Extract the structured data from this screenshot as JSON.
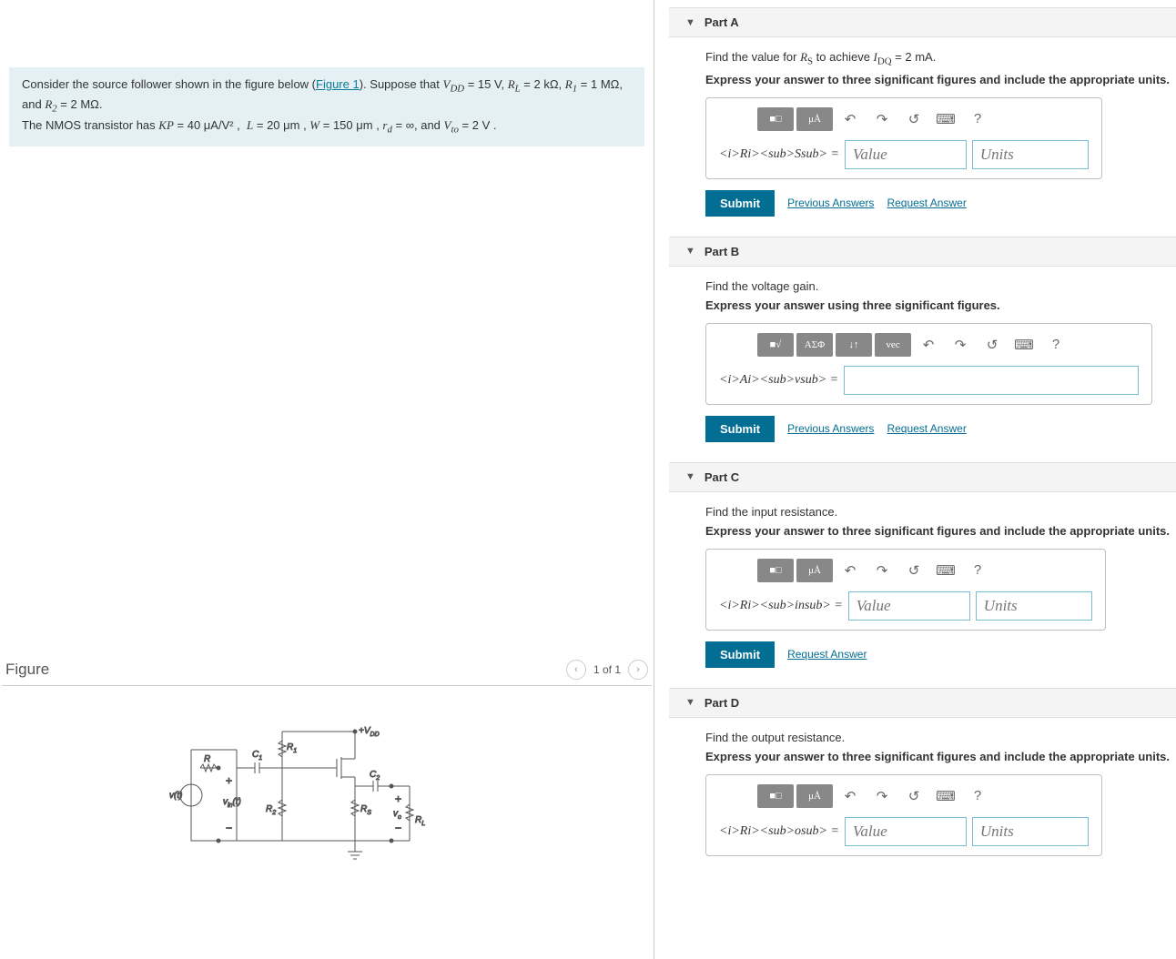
{
  "intro": {
    "preText": "Consider the source follower shown in the figure below (",
    "figLink": "Figure 1",
    "postText": "). Suppose that ",
    "params": "V_DD = 15 V, R_L = 2 kΩ, R_1 = 1 MΩ, and R_2 = 2 MΩ.",
    "line2pre": "The NMOS transistor has ",
    "line2": "KP = 40 μA/V² ,  L = 20 μm ,  W = 150 μm , r_d = ∞, and V_to = 2 V ."
  },
  "figure": {
    "title": "Figure",
    "pager": "1 of 1"
  },
  "parts": [
    {
      "id": "A",
      "title": "Part A",
      "prompt_html": "Find the value for R_S to achieve I_DQ = 2 mA.",
      "instruction": "Express your answer to three significant figures and include the appropriate units.",
      "style": "value_units",
      "symbol": "R_S =",
      "value_ph": "Value",
      "units_ph": "Units",
      "links": [
        "Previous Answers",
        "Request Answer"
      ]
    },
    {
      "id": "B",
      "title": "Part B",
      "prompt_html": "Find the voltage gain.",
      "instruction": "Express your answer using three significant figures.",
      "style": "expr",
      "symbol": "A_v =",
      "links": [
        "Previous Answers",
        "Request Answer"
      ]
    },
    {
      "id": "C",
      "title": "Part C",
      "prompt_html": "Find the input resistance.",
      "instruction": "Express your answer to three significant figures and include the appropriate units.",
      "style": "value_units",
      "symbol": "R_in =",
      "value_ph": "Value",
      "units_ph": "Units",
      "links": [
        "Request Answer"
      ]
    },
    {
      "id": "D",
      "title": "Part D",
      "prompt_html": "Find the output resistance.",
      "instruction": "Express your answer to three significant figures and include the appropriate units.",
      "style": "value_units",
      "symbol": "R_o =",
      "value_ph": "Value",
      "units_ph": "Units",
      "links": []
    }
  ],
  "submitLabel": "Submit",
  "tools_units": [
    "■□",
    "μÅ"
  ],
  "tools_units_icons": [
    "↶",
    "↷",
    "↺",
    "⌨",
    "?"
  ],
  "tools_expr": [
    "■√",
    "ΑΣΦ",
    "↓↑",
    "vec"
  ],
  "tools_expr_icons": [
    "↶",
    "↷",
    "↺",
    "⌨",
    "?"
  ],
  "circuit_labels": {
    "vdd": "+V_DD",
    "r1": "R_1",
    "r2": "R_2",
    "r": "R",
    "rs": "R_S",
    "rl": "R_L",
    "c1": "C_1",
    "c2": "C_2",
    "vt": "v(t)",
    "vin": "v_in(t)",
    "vo": "v_o"
  }
}
